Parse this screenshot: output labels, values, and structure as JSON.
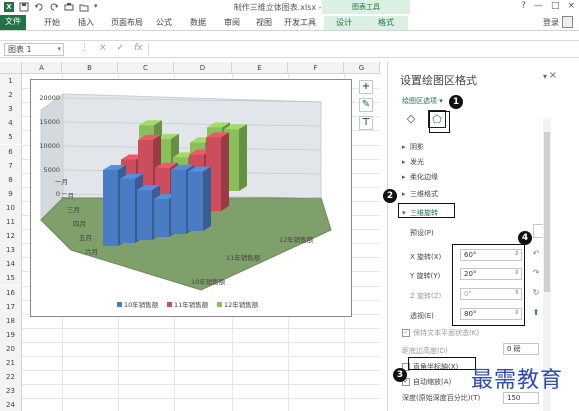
{
  "window": {
    "title": "制作三维立体图表.xlsx - Excel",
    "chart_tools": "图表工具",
    "login": "登录",
    "controls": [
      "?",
      "—",
      "□",
      "×"
    ]
  },
  "ribbon": {
    "tabs": [
      "文件",
      "开始",
      "插入",
      "页面布局",
      "公式",
      "数据",
      "审阅",
      "视图",
      "开发工具",
      "设计",
      "格式"
    ]
  },
  "formula_bar": {
    "name_box": "图表 1",
    "buttons": [
      "⋮",
      "×",
      "✓",
      "fx"
    ]
  },
  "sheet": {
    "columns": [
      "A",
      "B",
      "C",
      "D",
      "E",
      "F",
      "G"
    ],
    "rows": [
      "1",
      "2",
      "3",
      "4",
      "5",
      "6",
      "7",
      "8",
      "9",
      "10",
      "11",
      "12",
      "13",
      "14",
      "15",
      "16",
      "17",
      "18",
      "19",
      "20",
      "21",
      "22",
      "23",
      "24"
    ]
  },
  "chart_data": {
    "type": "bar",
    "variant": "3d-column",
    "categories": [
      "一月",
      "二月",
      "三月",
      "四月",
      "五月",
      "六月"
    ],
    "series": [
      {
        "name": "10年销售额",
        "color": "#4a7cc4",
        "values": [
          16000,
          13500,
          10500,
          8000,
          13500,
          12500
        ]
      },
      {
        "name": "11年销售额",
        "color": "#cc4e5c",
        "values": [
          14000,
          17500,
          11000,
          9000,
          12500,
          15500
        ]
      },
      {
        "name": "12年销售额",
        "color": "#8ac05a",
        "values": [
          17000,
          13500,
          9000,
          11500,
          14000,
          13000
        ]
      }
    ],
    "ylim": [
      0,
      20000
    ],
    "yticks": [
      "20000",
      "15000",
      "10000",
      "5000",
      "0"
    ],
    "depth_labels": [
      "10年销售额",
      "11年销售额",
      "12年销售额"
    ],
    "legend": [
      "10年销售额",
      "11年销售额",
      "12年销售额"
    ],
    "legend_position": "bottom"
  },
  "chart_tools": {
    "add": "+",
    "style": "✎",
    "filter": "⊤"
  },
  "pane": {
    "title": "设置绘图区格式",
    "subtitle": "绘图区选项 ▾",
    "sections": {
      "shadow": "阴影",
      "glow": "发光",
      "soft_edges": "柔化边缘",
      "bevel": "三维格式",
      "rotation": "三维旋转"
    },
    "presets_label": "预设(P)",
    "x_label": "X 旋转(X)",
    "x_value": "60°",
    "y_label": "Y 旋转(Y)",
    "y_value": "20°",
    "z_label": "Z 旋转(Z)",
    "z_value": "0°",
    "perspective_label": "透视(E)",
    "perspective_value": "80°",
    "keep_text_flat": "保持文本平面状态(K)",
    "distance_label": "距底边高度(D)",
    "distance_value": "0 磅",
    "right_angle_axes": "直角坐标轴(X)",
    "autoscale": "自动缩放(A)",
    "depth_label": "深度(原始深度百分比)(T)",
    "depth_value": "150"
  },
  "callouts": [
    "1",
    "2",
    "3",
    "4"
  ],
  "watermark": "最需教育",
  "colors": {
    "excel_green": "#217346",
    "series_blue": "#4a7cc4",
    "series_red": "#cc4e5c",
    "series_green": "#8ac05a"
  }
}
